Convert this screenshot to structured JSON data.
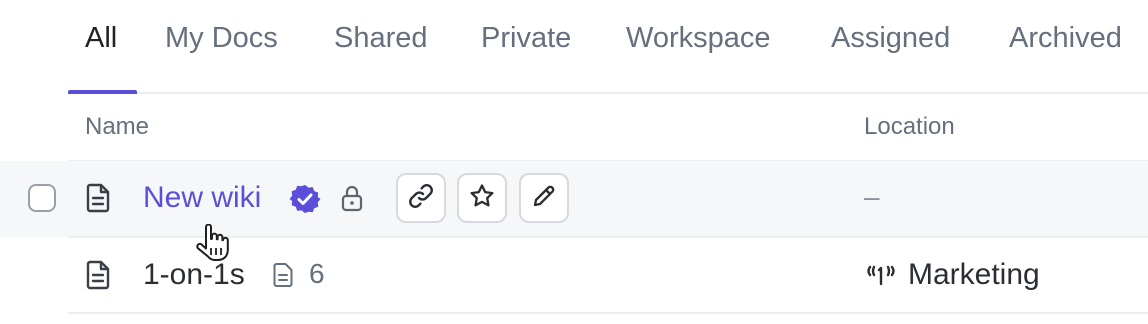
{
  "tabs": [
    {
      "label": "All",
      "active": true
    },
    {
      "label": "My Docs"
    },
    {
      "label": "Shared"
    },
    {
      "label": "Private"
    },
    {
      "label": "Workspace"
    },
    {
      "label": "Assigned"
    },
    {
      "label": "Archived"
    }
  ],
  "columns": {
    "name": "Name",
    "location": "Location"
  },
  "rows": [
    {
      "name": "New wiki",
      "verified": true,
      "locked": true,
      "location": "–",
      "actions": [
        "link-icon",
        "star-icon",
        "pencil-icon"
      ]
    },
    {
      "name": "1-on-1s",
      "subdoc_count": "6",
      "location": "Marketing",
      "location_icon": "space-icon"
    }
  ],
  "colors": {
    "accent": "#5b4fd9",
    "text": "#2a2e34",
    "muted": "#656f7d",
    "hover_row": "#f6f7f9"
  }
}
